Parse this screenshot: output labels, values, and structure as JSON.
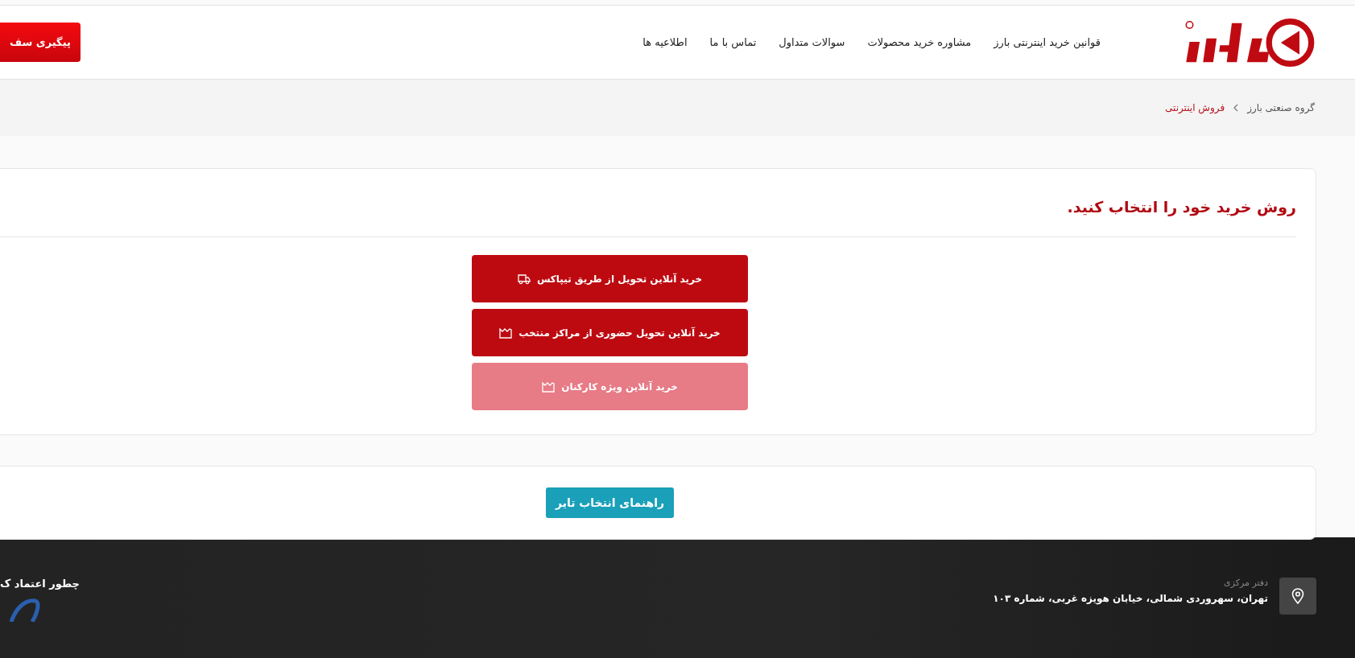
{
  "header": {
    "nav": [
      "قوانین خرید اینترنتی بارز",
      "مشاوره خرید محصولات",
      "سوالات متداول",
      "تماس با ما",
      "اطلاعیه ها"
    ],
    "track_button": "پیگیری سف"
  },
  "breadcrumb": [
    {
      "label": "گروه صنعتی بارز",
      "selected": false
    },
    {
      "label": "فروش اینترنتی",
      "selected": true
    }
  ],
  "purchase_card": {
    "title": "روش خرید خود را انتخاب کنید.",
    "options": [
      {
        "label": "خرید آنلاین تحویل از طریق تیپاکس",
        "kind": "delivery",
        "disabled": false
      },
      {
        "label": "خرید آنلاین تحویل حضوری از مراکز منتخب",
        "kind": "pickup",
        "disabled": false
      },
      {
        "label": "خرید آنلاین ویژه کارکنان",
        "kind": "pickup",
        "disabled": true
      }
    ]
  },
  "guide_button": "راهنمای انتخاب تایر",
  "footer": {
    "heading": "چطور اعتماد ک",
    "office_label": "دفتر مرکزی",
    "address": "تهران، سهروردی شمالی، خیابان هویزه غربی، شماره ۱۰۳"
  }
}
